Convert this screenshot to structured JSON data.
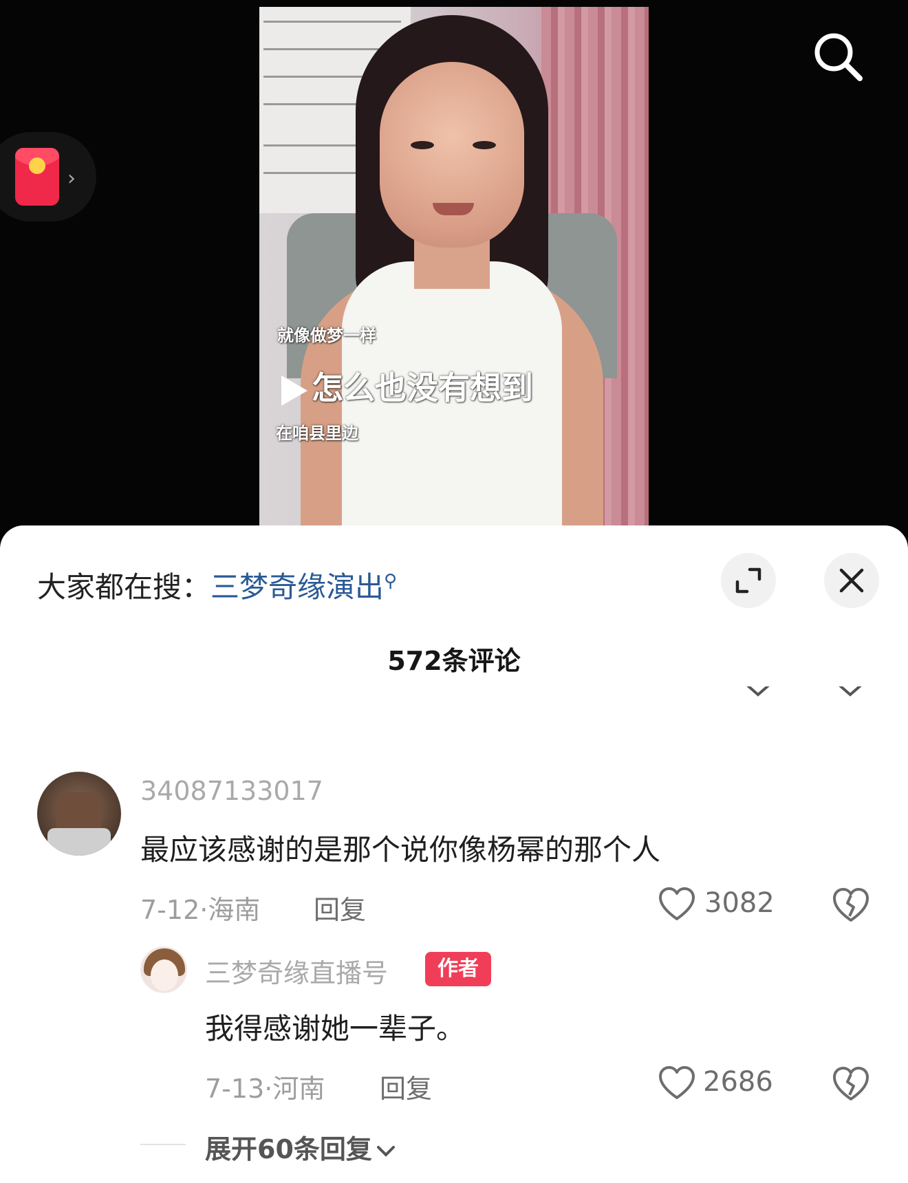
{
  "video": {
    "subtitle_1": "就像做梦一样",
    "subtitle_2": "怎么也没有想到",
    "subtitle_3": "在咱县里边"
  },
  "icons": {
    "redpacket": "red-packet-icon",
    "search": "search-icon",
    "expand": "expand-icon",
    "close": "close-icon",
    "like": "heart-icon",
    "dislike": "broken-heart-icon"
  },
  "colors": {
    "keyword": "#2a5a96",
    "author_badge": "#f13e58",
    "redpacket": "#f0284a"
  },
  "sheet": {
    "hot_search_label": "大家都在搜：",
    "hot_search_keyword": "三梦奇缘演出",
    "comment_count": "572条评论"
  },
  "comments": [
    {
      "username": "34087133017",
      "text": "最应该感谢的是那个说你像杨幂的那个人",
      "meta": "7-12·海南",
      "reply_label": "回复",
      "likes": "3082",
      "replies": [
        {
          "username": "三梦奇缘直播号",
          "badge": "作者",
          "text": "我得感谢她一辈子。",
          "meta": "7-13·河南",
          "reply_label": "回复",
          "likes": "2686"
        }
      ],
      "expand_label": "展开60条回复"
    }
  ]
}
